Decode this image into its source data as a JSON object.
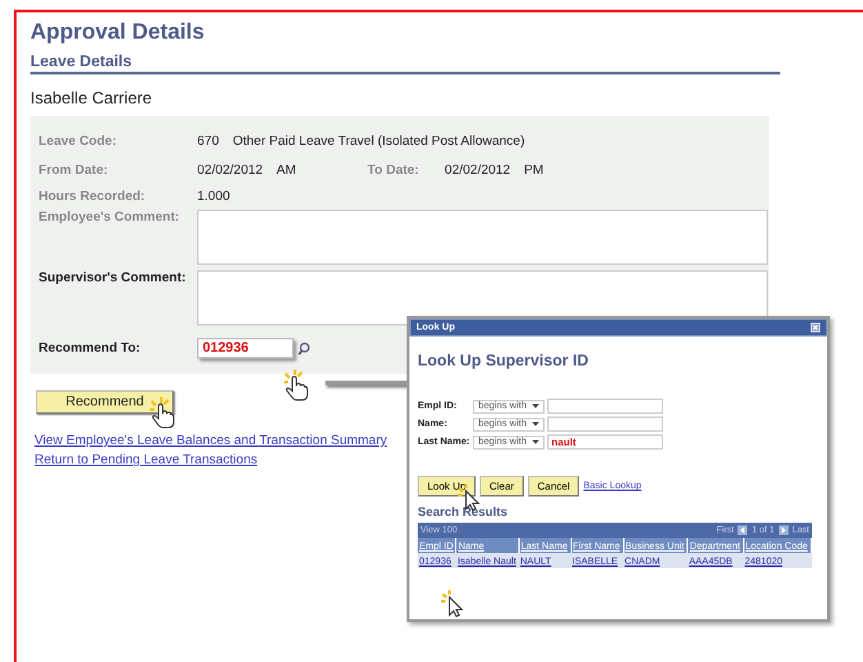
{
  "page": {
    "title": "Approval Details",
    "section": "Leave Details",
    "employee": "Isabelle Carriere"
  },
  "details": {
    "leave_code": {
      "label": "Leave Code:",
      "code": "670",
      "description": "Other Paid Leave Travel (Isolated Post Allowance)"
    },
    "from_date": {
      "label": "From Date:",
      "date": "02/02/2012",
      "period": "AM"
    },
    "to_date": {
      "label": "To Date:",
      "date": "02/02/2012",
      "period": "PM"
    },
    "hours": {
      "label": "Hours Recorded:",
      "value": "1.000"
    },
    "comments": [
      {
        "label": "Employee's Comment:",
        "editable": false
      },
      {
        "label": "Supervisor's Comment:",
        "editable": true
      }
    ],
    "recommend_to": {
      "label": "Recommend To:",
      "value": "012936"
    }
  },
  "recommend_button": "Recommend",
  "links": [
    "View Employee's Leave Balances and Transaction Summary",
    "Return to Pending Leave Transactions"
  ],
  "lookup": {
    "window_title": "Look Up",
    "heading": "Look Up Supervisor ID",
    "criteria": [
      {
        "label": "Empl ID:",
        "operator": "begins with"
      },
      {
        "label": "Name:",
        "operator": "begins with"
      },
      {
        "label": "Last Name:",
        "operator": "begins with",
        "value": "nault"
      }
    ],
    "buttons": [
      "Look Up",
      "Clear",
      "Cancel"
    ],
    "link": "Basic Lookup",
    "results_title": "Search Results",
    "grid": {
      "view": "View 100",
      "first": "First",
      "range": "1 of 1",
      "last": "Last",
      "columns": [
        "Empl ID",
        "Name",
        "Last Name",
        "First Name",
        "Business Unit",
        "Department",
        "Location Code"
      ],
      "rows": [
        [
          "012936",
          "Isabelle Nault",
          "NAULT",
          "ISABELLE",
          "CNADM",
          "AAA45DB",
          "2481020"
        ]
      ]
    }
  }
}
